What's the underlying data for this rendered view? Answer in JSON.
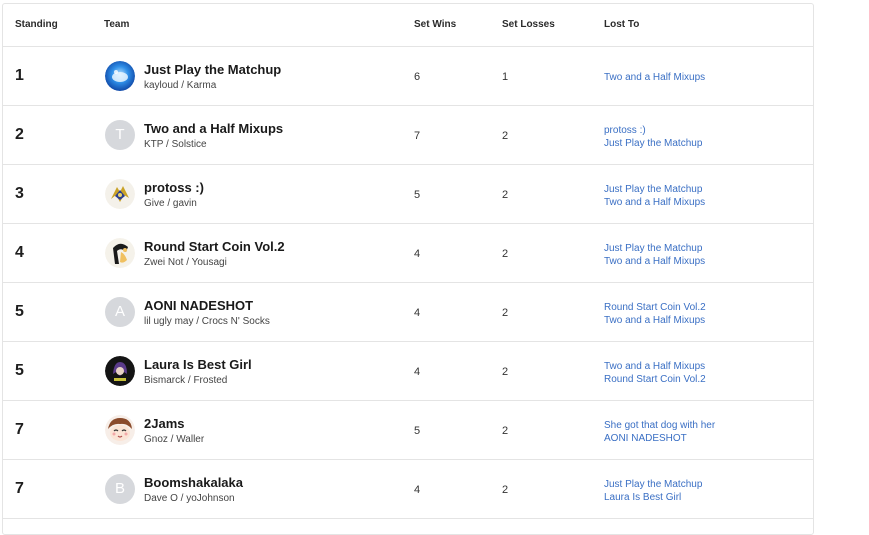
{
  "header": {
    "standing": "Standing",
    "team": "Team",
    "set_wins": "Set Wins",
    "set_losses": "Set Losses",
    "lost_to": "Lost To"
  },
  "rows": [
    {
      "standing": "1",
      "team": "Just Play the Matchup",
      "players": "kayloud / Karma",
      "avatar": "blue-orb-avatar",
      "avatar_letter": "",
      "wins": "6",
      "losses": "1",
      "lost_to": [
        "Two and a Half Mixups"
      ]
    },
    {
      "standing": "2",
      "team": "Two and a Half Mixups",
      "players": "KTP / Solstice",
      "avatar": "letter-avatar",
      "avatar_letter": "T",
      "wins": "7",
      "losses": "2",
      "lost_to": [
        "protoss :)",
        "Just Play the Matchup"
      ]
    },
    {
      "standing": "3",
      "team": "protoss :)",
      "players": "Give / gavin",
      "avatar": "protoss-emblem-avatar",
      "avatar_letter": "",
      "wins": "5",
      "losses": "2",
      "lost_to": [
        "Just Play the Matchup",
        "Two and a Half Mixups"
      ]
    },
    {
      "standing": "4",
      "team": "Round Start Coin Vol.2",
      "players": "Zwei Not / Yousagi",
      "avatar": "character-avatar",
      "avatar_letter": "",
      "wins": "4",
      "losses": "2",
      "lost_to": [
        "Just Play the Matchup",
        "Two and a Half Mixups"
      ]
    },
    {
      "standing": "5",
      "team": "AONI NADESHOT",
      "players": "lil ugly may / Crocs N' Socks",
      "avatar": "letter-avatar",
      "avatar_letter": "A",
      "wins": "4",
      "losses": "2",
      "lost_to": [
        "Round Start Coin Vol.2",
        "Two and a Half Mixups"
      ]
    },
    {
      "standing": "5",
      "team": "Laura Is Best Girl",
      "players": "Bismarck / Frosted",
      "avatar": "dark-character-avatar",
      "avatar_letter": "",
      "wins": "4",
      "losses": "2",
      "lost_to": [
        "Two and a Half Mixups",
        "Round Start Coin Vol.2"
      ]
    },
    {
      "standing": "7",
      "team": "2Jams",
      "players": "Gnoz / Waller",
      "avatar": "anime-face-avatar",
      "avatar_letter": "",
      "wins": "5",
      "losses": "2",
      "lost_to": [
        "She got that dog with her",
        "AONI NADESHOT"
      ]
    },
    {
      "standing": "7",
      "team": "Boomshakalaka",
      "players": "Dave O / yoJohnson",
      "avatar": "letter-avatar",
      "avatar_letter": "B",
      "wins": "4",
      "losses": "2",
      "lost_to": [
        "Just Play the Matchup",
        "Laura Is Best Girl"
      ]
    }
  ],
  "colors": {
    "link": "#3a6fc4",
    "border": "#e4e4e4",
    "letter_avatar_bg": "#d6d8dc"
  }
}
